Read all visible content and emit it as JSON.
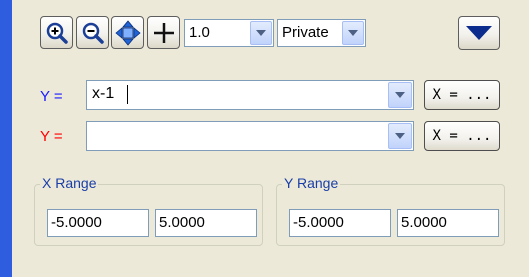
{
  "toolbar": {
    "buttons": [
      {
        "name": "zoom-in-icon"
      },
      {
        "name": "zoom-out-icon"
      },
      {
        "name": "pan-arrows-icon"
      },
      {
        "name": "crosshair-icon"
      }
    ],
    "scale_value": "1.0",
    "mode_value": "Private",
    "menu_icon": "triangle-down-icon"
  },
  "functions": [
    {
      "label": "Y =",
      "label_color": "#1a1aff",
      "value": "x-1",
      "x_button": "X = ..."
    },
    {
      "label": "Y =",
      "label_color": "#ff0000",
      "value": "",
      "x_button": "X = ..."
    }
  ],
  "x_range": {
    "title": "X Range",
    "min": "-5.0000",
    "max": "5.0000"
  },
  "y_range": {
    "title": "Y Range",
    "min": "-5.0000",
    "max": "5.0000"
  }
}
